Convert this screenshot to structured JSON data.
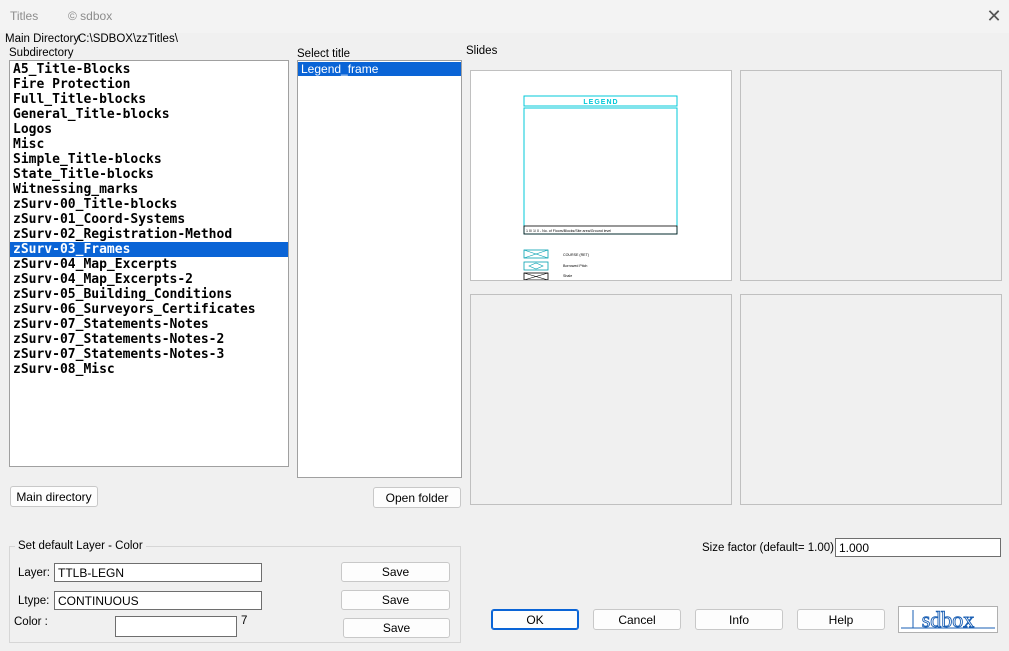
{
  "window": {
    "title": "Titles",
    "copyright": "© sdbox"
  },
  "main_dir": {
    "label": "Main Directory",
    "path": "C:\\SDBOX\\zzTitles\\"
  },
  "subdirectory": {
    "label": "Subdirectory",
    "items": [
      "A5_Title-Blocks",
      "Fire Protection",
      "Full_Title-blocks",
      "General_Title-blocks",
      "Logos",
      "Misc",
      "Simple_Title-blocks",
      "State_Title-blocks",
      "Witnessing_marks",
      "zSurv-00_Title-blocks",
      "zSurv-01_Coord-Systems",
      "zSurv-02_Registration-Method",
      "zSurv-03_Frames",
      "zSurv-04_Map_Excerpts",
      "zSurv-04_Map_Excerpts-2",
      "zSurv-05_Building_Conditions",
      "zSurv-06_Surveyors_Certificates",
      "zSurv-07_Statements-Notes",
      "zSurv-07_Statements-Notes-2",
      "zSurv-07_Statements-Notes-3",
      "zSurv-08_Misc"
    ],
    "selected_index": 12
  },
  "select_title": {
    "label": "Select title",
    "items": [
      "Legend_frame"
    ],
    "selected_index": 0
  },
  "slides": {
    "label": "Slides",
    "preview": {
      "header": "LEGEND",
      "footer": "1 0/ 1/ 0 - No. of Floors/Blocks/Site area/Ground level",
      "entries": [
        "COURSE (RET)",
        "Borrowed Pitch",
        "Shale"
      ]
    }
  },
  "buttons": {
    "main_directory": "Main directory",
    "open_folder": "Open folder",
    "ok": "OK",
    "cancel": "Cancel",
    "info": "Info",
    "help": "Help",
    "save": "Save"
  },
  "layer_group": {
    "label": "Set default Layer - Color",
    "layer_label": "Layer:",
    "layer_value": "TTLB-LEGN",
    "ltype_label": "Ltype:",
    "ltype_value": "CONTINUOUS",
    "color_label": "Color  :",
    "color_value": "",
    "color_number": "7"
  },
  "size_factor": {
    "label": "Size factor  (default= 1.00):",
    "value": "1.000"
  },
  "logo": {
    "text": "sdbox"
  },
  "colors": {
    "accent": "#0a64d6",
    "slide_line": "#00c8d8"
  }
}
